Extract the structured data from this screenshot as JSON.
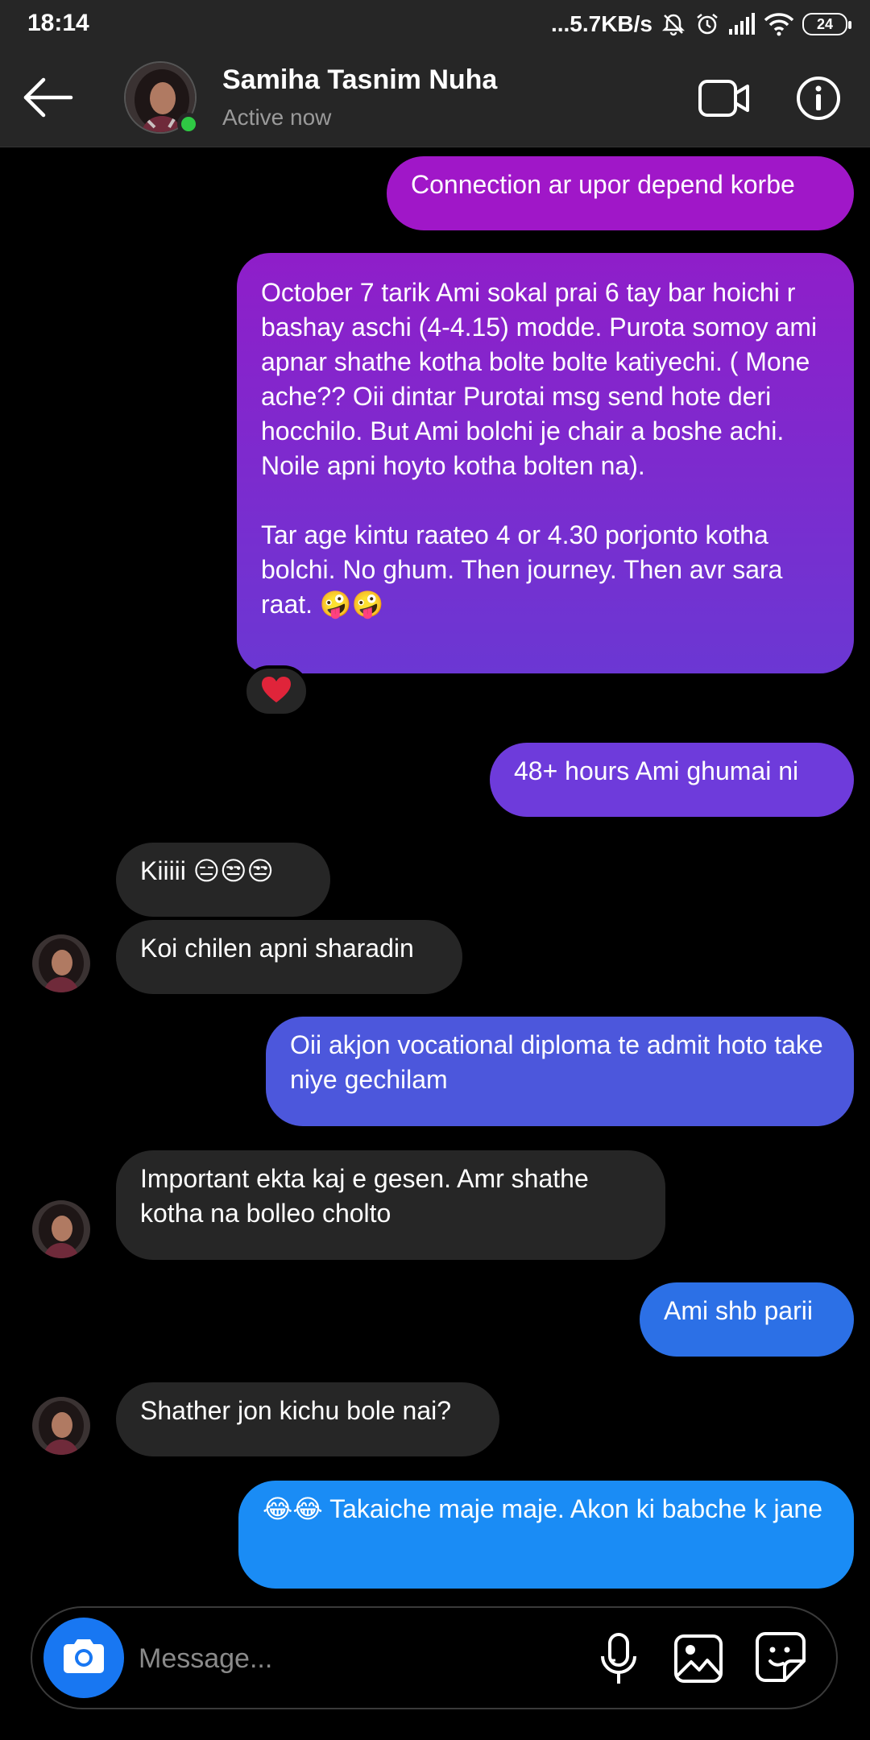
{
  "status_bar": {
    "time": "18:14",
    "network_speed": "...5.7KB/s",
    "battery": "24"
  },
  "header": {
    "contact_name": "Samiha Tasnim Nuha",
    "status": "Active now"
  },
  "messages": [
    {
      "direction": "outgoing",
      "text": "Connection ar upor depend korbe"
    },
    {
      "direction": "outgoing",
      "text": "October 7 tarik Ami sokal prai 6 tay bar hoichi r bashay aschi (4-4.15) modde. Purota somoy ami apnar shathe kotha bolte bolte katiyechi. ( Mone ache?? Oii dintar Purotai msg send hote deri hocchilo. But Ami bolchi je chair a boshe achi. Noile apni hoyto kotha bolten na).\n\nTar age kintu raateo 4 or 4.30 porjonto kotha bolchi. No ghum. Then journey. Then avr sara raat. 🤪🤪",
      "reaction": "❤️"
    },
    {
      "direction": "outgoing",
      "text": "48+ hours Ami ghumai ni"
    },
    {
      "direction": "incoming",
      "text": "Kiiiii 😑😒😒"
    },
    {
      "direction": "incoming",
      "text": "Koi chilen apni sharadin"
    },
    {
      "direction": "outgoing",
      "text": "Oii akjon vocational diploma te admit hoto take niye gechilam"
    },
    {
      "direction": "incoming",
      "text": "Important ekta kaj e gesen. Amr shathe kotha na bolleo cholto"
    },
    {
      "direction": "outgoing",
      "text": "Ami shb parii"
    },
    {
      "direction": "incoming",
      "text": "Shather jon kichu bole nai?"
    },
    {
      "direction": "outgoing",
      "text": "😂😂 Takaiche maje maje. Akon ki babche k jane"
    }
  ],
  "composer": {
    "placeholder": "Message..."
  },
  "colors": {
    "background": "#000000",
    "bar": "#262626",
    "incoming_bubble": "#262626",
    "gradient_top": "#a516c7",
    "gradient_mid": "#6b3fd6",
    "gradient_bottom": "#1a8cf5",
    "online": "#2fc944",
    "camera_button": "#1877f2"
  },
  "icons": [
    "back-arrow-icon",
    "video-call-icon",
    "info-icon",
    "camera-icon",
    "microphone-icon",
    "gallery-icon",
    "sticker-icon",
    "heart-icon",
    "mute-icon",
    "alarm-icon",
    "signal-icon",
    "wifi-icon"
  ]
}
